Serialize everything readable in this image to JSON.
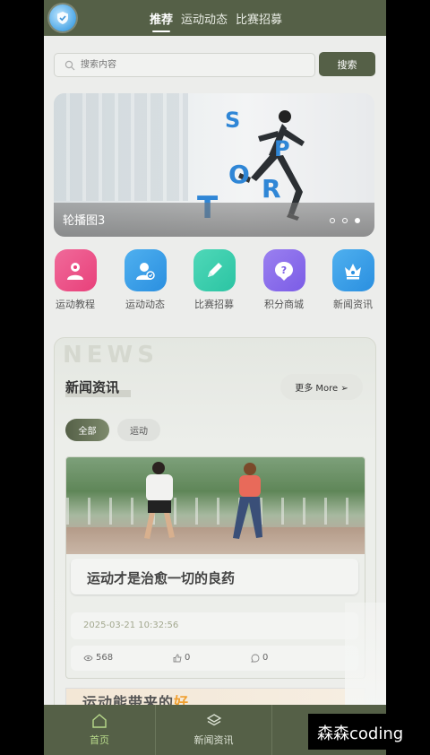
{
  "header": {
    "tabs": [
      {
        "label": "推荐",
        "active": true
      },
      {
        "label": "运动动态",
        "active": false
      },
      {
        "label": "比赛招募",
        "active": false
      }
    ]
  },
  "search": {
    "placeholder": "搜索内容",
    "button_label": "搜索"
  },
  "banner": {
    "caption": "轮播图3",
    "image_letters": [
      "S",
      "P",
      "O",
      "R",
      "T"
    ],
    "dots": 3,
    "active_dot": 3
  },
  "quick_links": [
    {
      "label": "运动教程",
      "icon": "user-icon",
      "color": "#e8407a"
    },
    {
      "label": "运动动态",
      "icon": "user-check-icon",
      "color": "#2a8fe0"
    },
    {
      "label": "比赛招募",
      "icon": "pencil-icon",
      "color": "#2bc4a3"
    },
    {
      "label": "积分商城",
      "icon": "question-icon",
      "color": "#7b5ce6"
    },
    {
      "label": "新闻资讯",
      "icon": "crown-icon",
      "color": "#2a8fe0"
    }
  ],
  "news": {
    "bg_text": "NEWS",
    "title": "新闻资讯",
    "more_label": "更多 More ➢",
    "filters": [
      {
        "label": "全部",
        "active": true
      },
      {
        "label": "运动",
        "active": false
      }
    ],
    "articles": [
      {
        "title": "运动才是治愈一切的良药",
        "date": "2025-03-21 10:32:56",
        "views": "568",
        "likes": "0",
        "comments": "0"
      },
      {
        "title_main": "运动能带来的",
        "title_highlight": "好"
      }
    ]
  },
  "bottom_nav": [
    {
      "label": "首页",
      "icon": "home-icon",
      "active": true
    },
    {
      "label": "新闻资讯",
      "icon": "layers-icon",
      "active": false
    }
  ],
  "watermark": "森森coding",
  "colors": {
    "primary": "#556047",
    "accent_text": "#b7d98a"
  }
}
